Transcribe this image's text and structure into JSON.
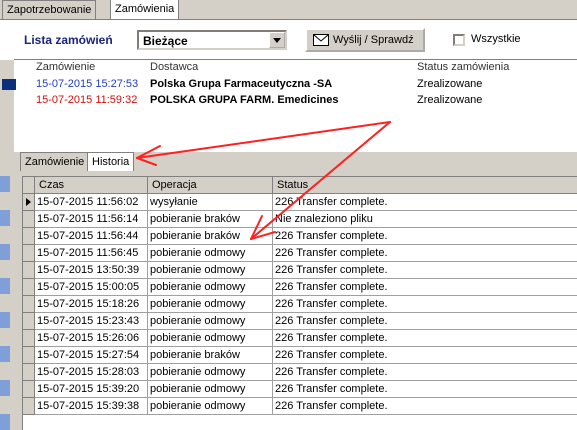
{
  "tabs": [
    "Zapotrzebowanie",
    "Zamówienia"
  ],
  "toolbar": {
    "title": "Lista zamówień",
    "filter_value": "Bieżące",
    "send_button": "Wyślij / Sprawdź",
    "all_label": "Wszystkie"
  },
  "orders": {
    "headers": [
      "Zamówienie",
      "Dostawca",
      "Status zamówienia"
    ],
    "rows": [
      {
        "date": "15-07-2015 15:27:53",
        "supplier": "Polska Grupa Farmaceutyczna -SA",
        "status": "Zrealizowane"
      },
      {
        "date": "15-07-2015 11:59:32",
        "supplier": "POLSKA GRUPA FARM. Emedicines",
        "status": "Zrealizowane"
      }
    ]
  },
  "subtabs": [
    "Zamówienie",
    "Historia"
  ],
  "history": {
    "headers": [
      "Czas",
      "Operacja",
      "Status"
    ],
    "rows": [
      [
        "15-07-2015 11:56:02",
        "wysyłanie",
        "226 Transfer complete."
      ],
      [
        "15-07-2015 11:56:14",
        "pobieranie braków",
        "Nie znaleziono pliku"
      ],
      [
        "15-07-2015 11:56:44",
        "pobieranie braków",
        "226 Transfer complete."
      ],
      [
        "15-07-2015 11:56:45",
        "pobieranie odmowy",
        "226 Transfer complete."
      ],
      [
        "15-07-2015 13:50:39",
        "pobieranie odmowy",
        "226 Transfer complete."
      ],
      [
        "15-07-2015 15:00:05",
        "pobieranie odmowy",
        "226 Transfer complete."
      ],
      [
        "15-07-2015 15:18:26",
        "pobieranie odmowy",
        "226 Transfer complete."
      ],
      [
        "15-07-2015 15:23:43",
        "pobieranie odmowy",
        "226 Transfer complete."
      ],
      [
        "15-07-2015 15:26:06",
        "pobieranie odmowy",
        "226 Transfer complete."
      ],
      [
        "15-07-2015 15:27:54",
        "pobieranie braków",
        "226 Transfer complete."
      ],
      [
        "15-07-2015 15:28:03",
        "pobieranie odmowy",
        "226 Transfer complete."
      ],
      [
        "15-07-2015 15:39:20",
        "pobieranie odmowy",
        "226 Transfer complete."
      ],
      [
        "15-07-2015 15:39:38",
        "pobieranie odmowy",
        "226 Transfer complete."
      ]
    ]
  },
  "colors": {
    "order1_date": "#1f3fbf",
    "order2_date": "#d01010",
    "annotation": "#ff2020"
  }
}
